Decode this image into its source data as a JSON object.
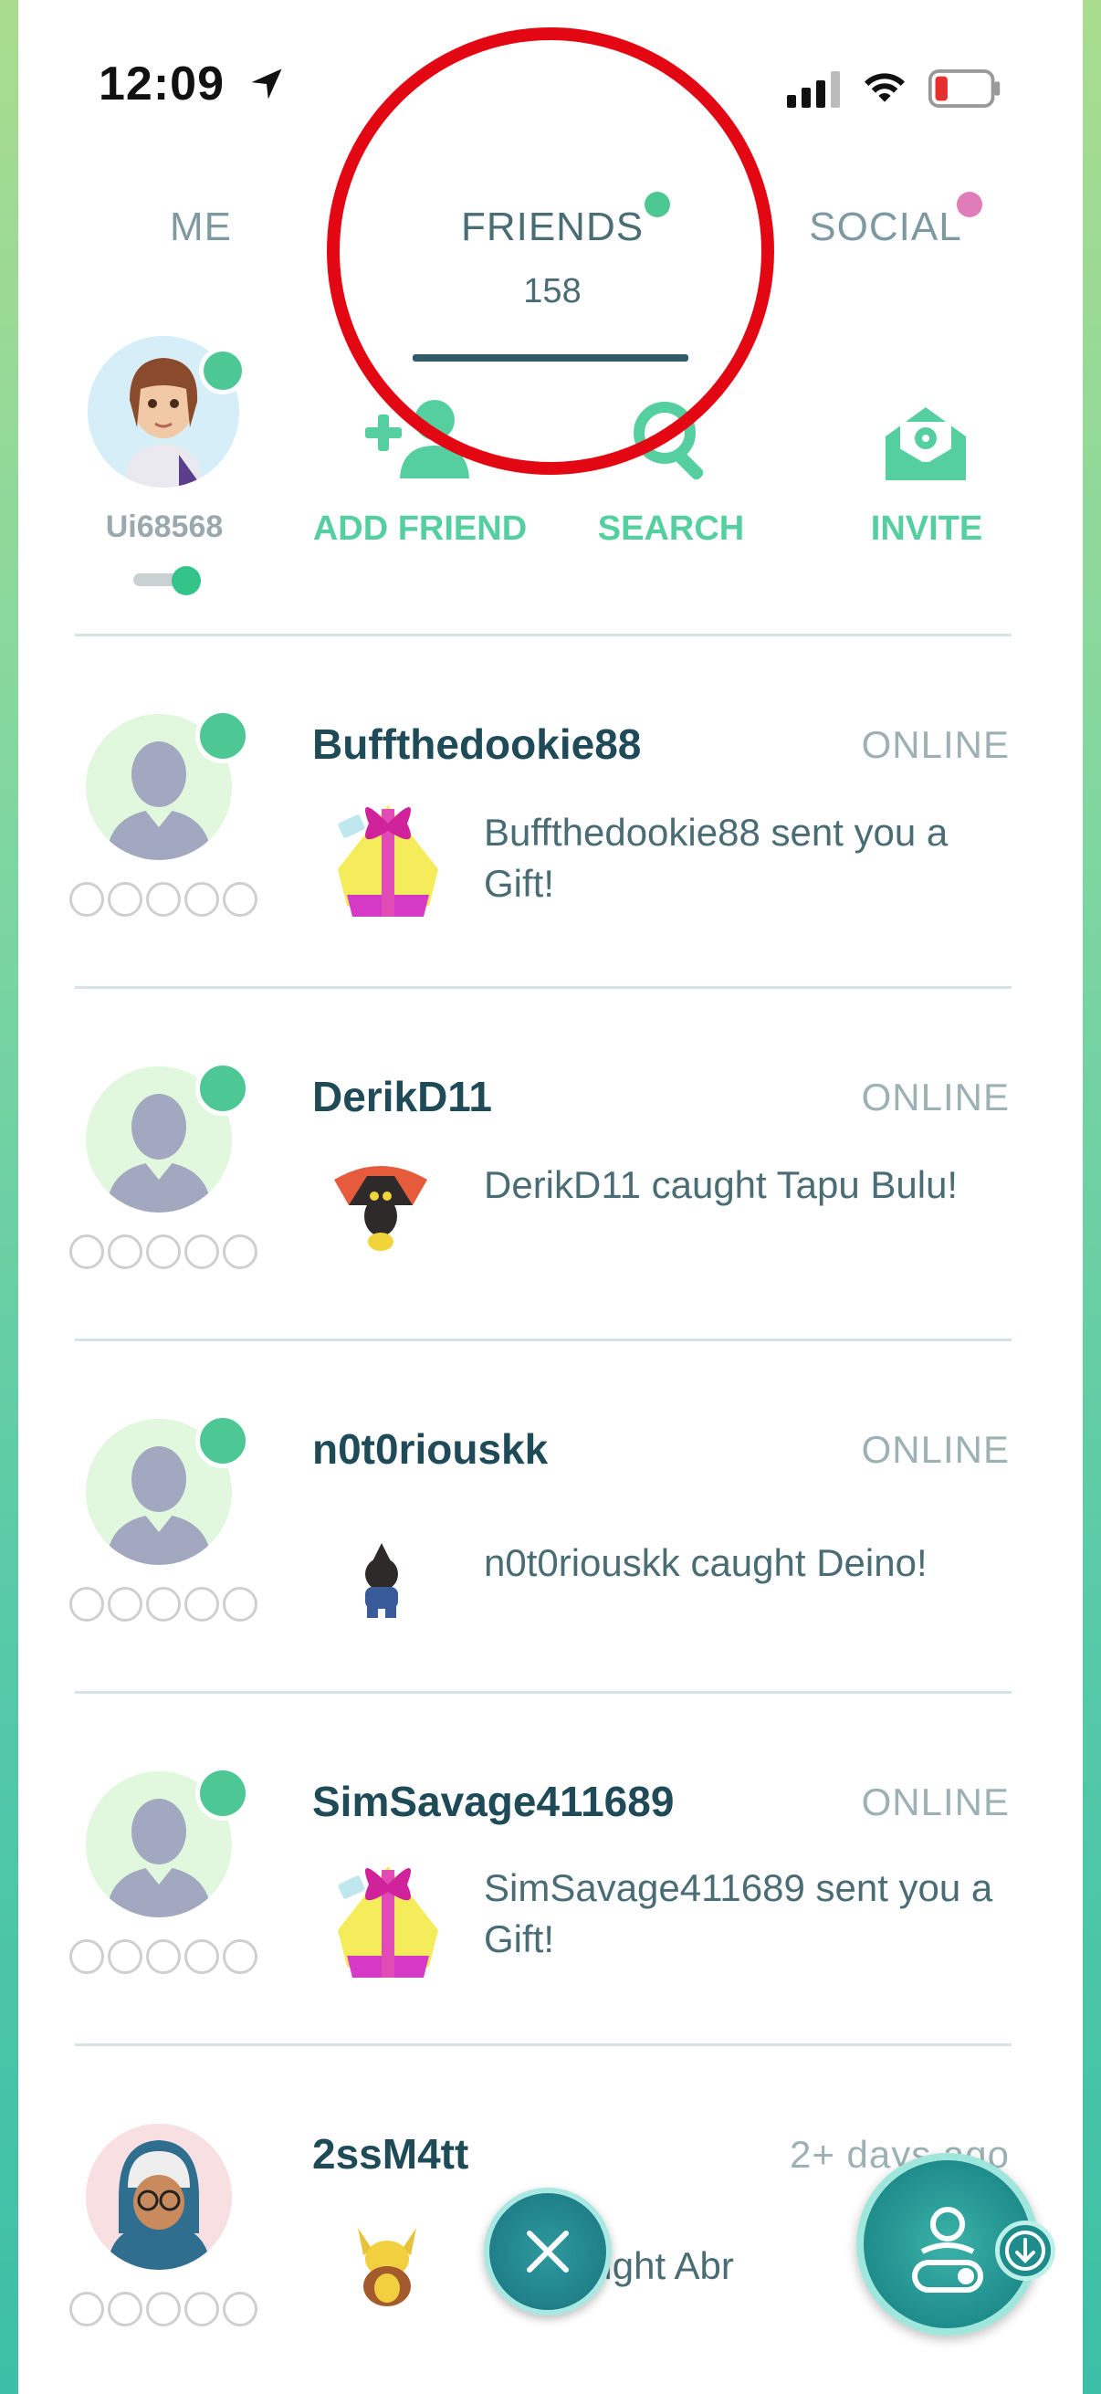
{
  "status_bar": {
    "time": "12:09"
  },
  "tabs": [
    {
      "label": "ME"
    },
    {
      "label": "FRIENDS",
      "count": "158"
    },
    {
      "label": "SOCIAL"
    }
  ],
  "profile": {
    "username": "Ui68568"
  },
  "actions": [
    {
      "label": "ADD FRIEND",
      "icon": "add-friend-icon"
    },
    {
      "label": "SEARCH",
      "icon": "search-icon"
    },
    {
      "label": "INVITE",
      "icon": "invite-envelope-icon"
    }
  ],
  "friends": [
    {
      "name": "Buffthedookie88",
      "status": "ONLINE",
      "message": "Buffthedookie88 sent you a Gift!",
      "item": "gift-icon"
    },
    {
      "name": "DerikD11",
      "status": "ONLINE",
      "message": "DerikD11 caught Tapu Bulu!",
      "item": "pokemon-icon"
    },
    {
      "name": "n0t0riouskk",
      "status": "ONLINE",
      "message": "n0t0riouskk caught Deino!",
      "item": "pokemon-icon"
    },
    {
      "name": "SimSavage411689",
      "status": "ONLINE",
      "message": "SimSavage411689 sent you a Gift!",
      "item": "gift-icon"
    },
    {
      "name": "2ssM4tt",
      "status": "2+ days ago",
      "message": "2ssM4tt caught Abra!",
      "message_visible": "tt caught Abr",
      "item": "pokemon-icon"
    }
  ],
  "colors": {
    "accent": "#55cfa0",
    "online_dot": "#4dc894",
    "social_dot": "#e07db8",
    "highlight_circle": "#e30613",
    "name_text": "#1f4a58"
  }
}
